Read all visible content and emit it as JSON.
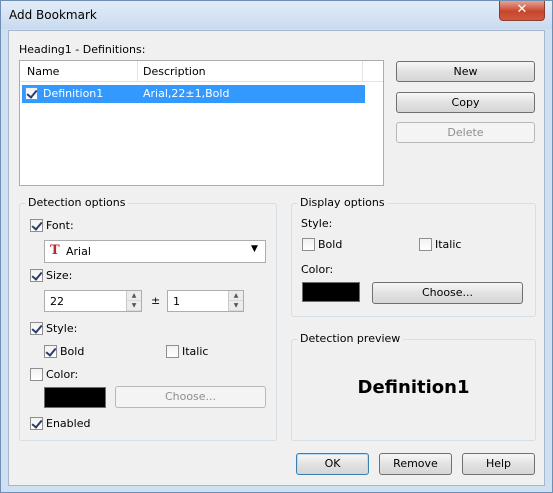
{
  "window": {
    "title": "Add Bookmark",
    "close_glyph": "✕"
  },
  "heading": "Heading1 - Definitions:",
  "list": {
    "columns": [
      "Name",
      "Description"
    ],
    "rows": [
      {
        "name": "Definition1",
        "description": "Arial,22±1,Bold",
        "checked": true
      }
    ]
  },
  "side_buttons": {
    "new": "New",
    "copy": "Copy",
    "delete": "Delete"
  },
  "detection": {
    "title": "Detection options",
    "font_label": "Font:",
    "font_value": "Arial",
    "size_label": "Size:",
    "size_value": "22",
    "plusminus": "±",
    "tolerance_value": "1",
    "style_label": "Style:",
    "bold_label": "Bold",
    "italic_label": "Italic",
    "color_label": "Color:",
    "choose_label": "Choose...",
    "enabled_label": "Enabled"
  },
  "display": {
    "title": "Display options",
    "style_label": "Style:",
    "bold_label": "Bold",
    "italic_label": "Italic",
    "color_label": "Color:",
    "choose_label": "Choose..."
  },
  "preview": {
    "title": "Detection preview",
    "text": "Definition1"
  },
  "footer": {
    "ok": "OK",
    "remove": "Remove",
    "help": "Help"
  },
  "icons": {
    "font_icon": "font-type-icon",
    "dropdown": "chevron-down-icon"
  },
  "colors": {
    "selection": "#3399ff",
    "swatch": "#000000"
  }
}
